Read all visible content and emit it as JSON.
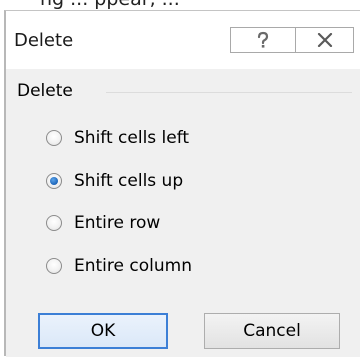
{
  "background_text": "ng    ...    ppear,    ...",
  "dialog": {
    "title": "Delete",
    "help_icon": "question-mark",
    "close_icon": "close-x",
    "group_label": "Delete",
    "options": [
      {
        "label": "Shift cells left",
        "selected": false
      },
      {
        "label": "Shift cells up",
        "selected": true
      },
      {
        "label": "Entire row",
        "selected": false
      },
      {
        "label": "Entire column",
        "selected": false
      }
    ],
    "ok_label": "OK",
    "cancel_label": "Cancel",
    "accent_color": "#3c7fd6"
  }
}
